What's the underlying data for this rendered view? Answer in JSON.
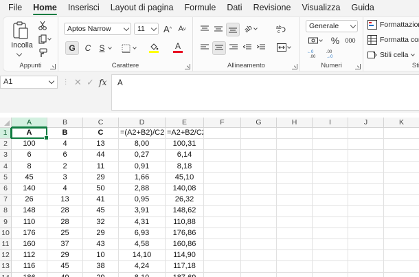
{
  "menu": {
    "tabs": [
      "File",
      "Home",
      "Inserisci",
      "Layout di pagina",
      "Formule",
      "Dati",
      "Revisione",
      "Visualizza",
      "Guida"
    ]
  },
  "ribbon": {
    "clipboard": {
      "paste_label": "Incolla",
      "group_label": "Appunti"
    },
    "font": {
      "font_name": "Aptos Narrow",
      "font_size": "11",
      "grow_label": "A",
      "shrink_label": "A",
      "bold_label": "G",
      "italic_label": "C",
      "underline_label": "S",
      "fill_label": "",
      "color_label": "A",
      "group_label": "Carattere"
    },
    "alignment": {
      "group_label": "Allineamento"
    },
    "number": {
      "format": "Generale",
      "percent_label": "%",
      "thousands_label": "000",
      "group_label": "Numeri"
    },
    "styles": {
      "conditional_label": "Formattazione",
      "table_label": "Formatta com",
      "cell_styles_label": "Stili cella",
      "group_label": "Sti"
    }
  },
  "formula_bar": {
    "name_box": "A1",
    "fx_label": "fx",
    "content": "A"
  },
  "grid": {
    "columns": [
      "A",
      "B",
      "C",
      "D",
      "E",
      "F",
      "G",
      "H",
      "I",
      "J",
      "K"
    ],
    "rows": [
      {
        "n": "1",
        "cells": [
          "A",
          "B",
          "C",
          "=(A2+B2)/C2",
          "=A2+B2/C2"
        ]
      },
      {
        "n": "2",
        "cells": [
          "100",
          "4",
          "13",
          "8,00",
          "100,31"
        ]
      },
      {
        "n": "3",
        "cells": [
          "6",
          "6",
          "44",
          "0,27",
          "6,14"
        ]
      },
      {
        "n": "4",
        "cells": [
          "8",
          "2",
          "11",
          "0,91",
          "8,18"
        ]
      },
      {
        "n": "5",
        "cells": [
          "45",
          "3",
          "29",
          "1,66",
          "45,10"
        ]
      },
      {
        "n": "6",
        "cells": [
          "140",
          "4",
          "50",
          "2,88",
          "140,08"
        ]
      },
      {
        "n": "7",
        "cells": [
          "26",
          "13",
          "41",
          "0,95",
          "26,32"
        ]
      },
      {
        "n": "8",
        "cells": [
          "148",
          "28",
          "45",
          "3,91",
          "148,62"
        ]
      },
      {
        "n": "9",
        "cells": [
          "110",
          "28",
          "32",
          "4,31",
          "110,88"
        ]
      },
      {
        "n": "10",
        "cells": [
          "176",
          "25",
          "29",
          "6,93",
          "176,86"
        ]
      },
      {
        "n": "11",
        "cells": [
          "160",
          "37",
          "43",
          "4,58",
          "160,86"
        ]
      },
      {
        "n": "12",
        "cells": [
          "112",
          "29",
          "10",
          "14,10",
          "114,90"
        ]
      },
      {
        "n": "13",
        "cells": [
          "116",
          "45",
          "38",
          "4,24",
          "117,18"
        ]
      },
      {
        "n": "14",
        "cells": [
          "186",
          "49",
          "29",
          "8,10",
          "187,69"
        ]
      }
    ]
  },
  "colors": {
    "accent": "#107c41",
    "selected_header": "#d3f0e0",
    "fill_swatch": "#ffff00",
    "font_color": "#e81123"
  }
}
